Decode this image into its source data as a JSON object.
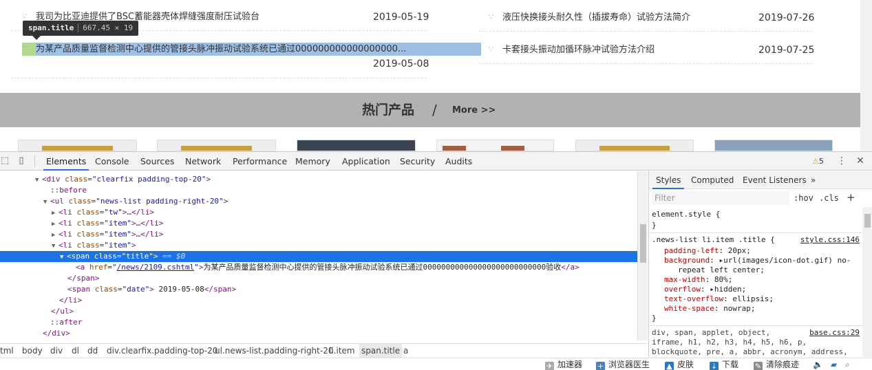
{
  "news": {
    "left": [
      {
        "title": "我司为比亚迪提供了BSC蓄能器壳体焊缝强度耐压试验台",
        "date": "2019-05-19"
      },
      {
        "title": "为某产品质量监督检测中心提供的管接头脉冲振动试验系统已通过000000000000000000...",
        "date": "2019-05-08"
      }
    ],
    "right": [
      {
        "title": "液压快换接头耐久性（插拔寿命）试验方法简介",
        "date": "2019-07-26"
      },
      {
        "title": "卡套接头振动加循环脉冲试验方法介绍",
        "date": "2019-07-25"
      }
    ],
    "dot": "∵"
  },
  "inspect_tooltip": {
    "selector": "span.title",
    "size": "667.45 × 19"
  },
  "hot": {
    "title": "热门产品",
    "slash": "/",
    "more": "More >>"
  },
  "devtools": {
    "tabs": [
      "Elements",
      "Console",
      "Sources",
      "Network",
      "Performance",
      "Memory",
      "Application",
      "Security",
      "Audits"
    ],
    "active_tab": "Elements",
    "warnings": "5",
    "kebab": "⋮",
    "close": "✕",
    "dom": {
      "l0": {
        "tag_open": "<div ",
        "attr": "class",
        "val": "\"clearfix padding-top-20\"",
        "tag_close": ">"
      },
      "l1": "::before",
      "l2": {
        "tag_open": "<ul ",
        "attr": "class",
        "val": "\"news-list padding-right-20\"",
        "tag_close": ">"
      },
      "l3": {
        "tag_open": "<li ",
        "attr": "class",
        "val": "\"tw\"",
        "rest": ">…</li>"
      },
      "l4": {
        "tag_open": "<li ",
        "attr": "class",
        "val": "\"item\"",
        "rest": ">…</li>"
      },
      "l5": {
        "tag_open": "<li ",
        "attr": "class",
        "val": "\"item\"",
        "rest": ">…</li>"
      },
      "l6": {
        "tag_open": "<li ",
        "attr": "class",
        "val": "\"item\"",
        "tag_close": ">"
      },
      "l7": {
        "tag_open": "<span ",
        "attr": "class",
        "val": "\"title\"",
        "tag_close": ">",
        "eq": " == $0"
      },
      "l8": {
        "tag_open": "<a ",
        "attr": "href",
        "val_pre": "=\"",
        "href": "/news/2109.cshtml",
        "val_post": "\"",
        "tag_close": ">",
        "text": "为某产品质量监督检测中心提供的管接头脉冲振动试验系统已通过000000000000000000000000000验收",
        "end": "</a>"
      },
      "l9": "</span>",
      "l10": {
        "tag_open": "<span ",
        "attr": "class",
        "val": "\"date\"",
        "tag_close": ">",
        "text": " 2019-05-08",
        "end": "</span>"
      },
      "l11": "</li>",
      "l12": "</ul>",
      "l13": "::after",
      "l14": "</div>"
    },
    "breadcrumbs": [
      "tml",
      "body",
      "div",
      "dl",
      "dd",
      "div.clearfix.padding-top-20",
      "ul.news-list.padding-right-20",
      "li.item",
      "span.title",
      "a"
    ],
    "styles": {
      "tabs": [
        "Styles",
        "Computed",
        "Event Listeners",
        "»"
      ],
      "filter_placeholder": "Filter",
      "hov": ":hov",
      "cls": ".cls",
      "plus": "+",
      "element_style": "element.style {",
      "close_brace": "}",
      "rule_selector": ".news-list li.item .title {",
      "rule_source": "style.css:146",
      "props": [
        {
          "name": "padding-left",
          "value": "20px;"
        },
        {
          "name": "background",
          "value": "▸url(images/icon-dot.gif) no-"
        },
        {
          "name": "",
          "value": "repeat left center;"
        },
        {
          "name": "max-width",
          "value": "80%;"
        },
        {
          "name": "overflow",
          "value": "▸hidden;"
        },
        {
          "name": "text-overflow",
          "value": "ellipsis;"
        },
        {
          "name": "white-space",
          "value": "nowrap;"
        }
      ],
      "base_selector_1": "div, span, applet, object,",
      "base_source": "base.css:29",
      "base_selector_2": "iframe, h1, h2, h3, h4, h5, h6, p,",
      "base_selector_3": "blockquote, pre, a, abbr, acronym, address,"
    }
  },
  "statusbar": {
    "items": [
      "加速器",
      "浏览器医生",
      "皮肤",
      "下载",
      "清除痕迹"
    ]
  },
  "colors": {
    "accent": "#1a73e8",
    "highlight": "#9fc0e5",
    "hot_bar": "#b2b2b2"
  }
}
